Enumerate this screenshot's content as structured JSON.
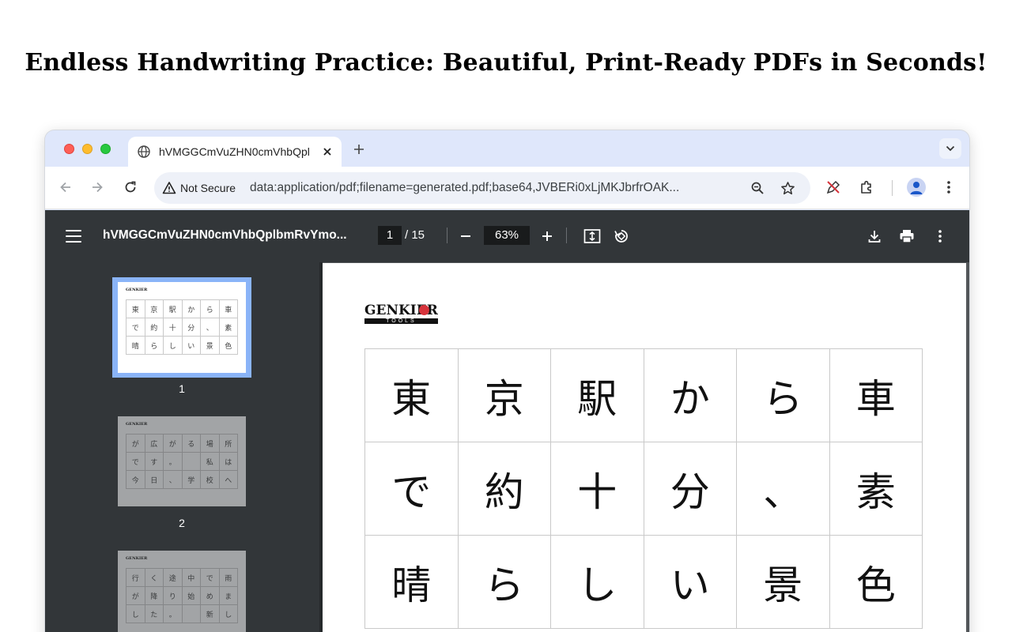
{
  "headline": "Endless Handwriting Practice: Beautiful, Print-Ready PDFs in Seconds!",
  "browser": {
    "tab_title": "hVMGGCmVuZHN0cmVhbQpl",
    "address_security": "Not Secure",
    "address_url": "data:application/pdf;filename=generated.pdf;base64,JVBERi0xLjMKJbrfrOAK..."
  },
  "pdf_viewer": {
    "title": "hVMGGCmVuZHN0cmVhbQplbmRvYmo...",
    "current_page": "1",
    "total_pages": "/ 15",
    "zoom": "63%"
  },
  "thumbnails": [
    {
      "number": "1",
      "selected": true,
      "rows": [
        [
          "東",
          "京",
          "駅",
          "か",
          "ら",
          "車"
        ],
        [
          "で",
          "約",
          "十",
          "分",
          "、",
          "素"
        ],
        [
          "晴",
          "ら",
          "し",
          "い",
          "景",
          "色"
        ]
      ]
    },
    {
      "number": "2",
      "selected": false,
      "rows": [
        [
          "が",
          "広",
          "が",
          "る",
          "場",
          "所"
        ],
        [
          "で",
          "す",
          "。",
          "",
          "私",
          "は"
        ],
        [
          "今",
          "日",
          "、",
          "学",
          "校",
          "へ"
        ]
      ]
    },
    {
      "number": "",
      "selected": false,
      "rows": [
        [
          "行",
          "く",
          "途",
          "中",
          "で",
          "雨"
        ],
        [
          "が",
          "降",
          "り",
          "始",
          "め",
          "ま"
        ],
        [
          "し",
          "た",
          "。",
          "",
          "新",
          "し"
        ]
      ]
    }
  ],
  "page": {
    "logo_brand": "GENKIER",
    "logo_sub": "TOOLS",
    "grid": [
      [
        "東",
        "京",
        "駅",
        "か",
        "ら",
        "車"
      ],
      [
        "で",
        "約",
        "十",
        "分",
        "、",
        "素"
      ],
      [
        "晴",
        "ら",
        "し",
        "い",
        "景",
        "色"
      ]
    ]
  }
}
